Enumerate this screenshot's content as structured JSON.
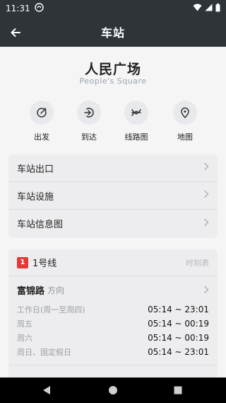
{
  "status": {
    "time": "11:31"
  },
  "appbar": {
    "title": "车站"
  },
  "station": {
    "name_cn": "人民广场",
    "name_en": "People's Square"
  },
  "quick_actions": [
    {
      "label": "出发",
      "icon": "depart-icon"
    },
    {
      "label": "到达",
      "icon": "arrive-icon"
    },
    {
      "label": "线路图",
      "icon": "route-map-icon"
    },
    {
      "label": "地图",
      "icon": "map-pin-icon"
    }
  ],
  "menu": [
    {
      "label": "车站出口"
    },
    {
      "label": "车站设施"
    },
    {
      "label": "车站信息图"
    }
  ],
  "line": {
    "badge": "1",
    "name": "1号线",
    "timetable_label": "时刻表",
    "color": "#e53935",
    "direction": {
      "name": "富锦路",
      "suffix": "方向"
    },
    "schedule": [
      {
        "day": "工作日(周一至周四)",
        "time": "05:14 ~ 23:01"
      },
      {
        "day": "周五",
        "time": "05:14 ~ 00:19"
      },
      {
        "day": "周六",
        "time": "05:14 ~ 00:19"
      },
      {
        "day": "周日、国定假日",
        "time": "05:14 ~ 23:01"
      }
    ]
  }
}
